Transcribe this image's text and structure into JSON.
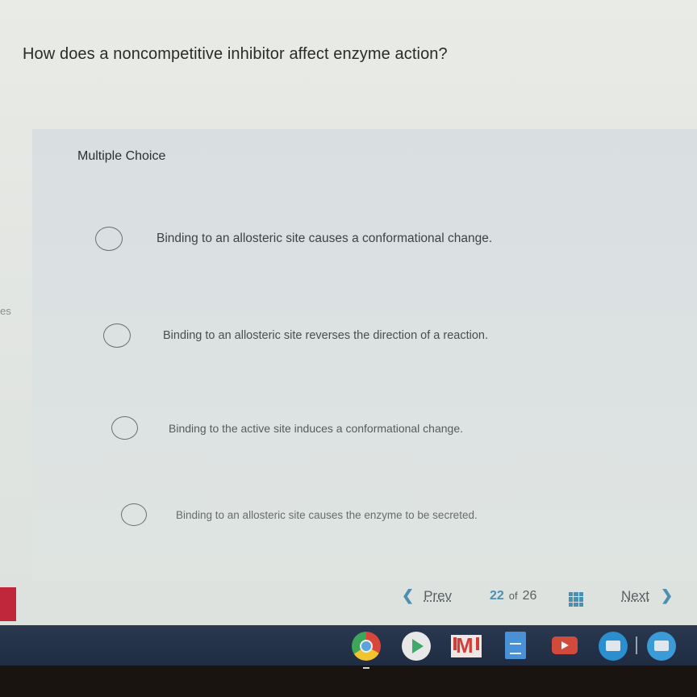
{
  "question": {
    "text": "How does a noncompetitive inhibitor affect enzyme action?"
  },
  "left_edge": {
    "partial_label": "es"
  },
  "multiple_choice": {
    "label": "Multiple Choice",
    "options": [
      {
        "text": "Binding to an allosteric site causes a conformational change.",
        "selected": false
      },
      {
        "text": "Binding to an allosteric site reverses the direction of a reaction.",
        "selected": false
      },
      {
        "text": "Binding to the active site induces a conformational change.",
        "selected": false
      },
      {
        "text": "Binding to an allosteric site causes the enzyme to be secreted.",
        "selected": false
      }
    ]
  },
  "navigation": {
    "prev_label": "Prev",
    "prev_icon": "chevron-left-icon",
    "current_page": "22",
    "of_label": "of",
    "total_pages": "26",
    "grid_icon": "grid-icon",
    "next_label": "Next",
    "next_icon": "chevron-right-icon",
    "accent_color": "#4d8fb0"
  },
  "shelf": {
    "apps": [
      {
        "name": "Chrome",
        "icon": "chrome-icon"
      },
      {
        "name": "Play Store",
        "icon": "play-store-icon"
      },
      {
        "name": "Gmail",
        "icon": "gmail-icon"
      },
      {
        "name": "Docs",
        "icon": "docs-icon"
      },
      {
        "name": "YouTube",
        "icon": "youtube-icon"
      },
      {
        "name": "Files",
        "icon": "files-icon"
      },
      {
        "name": "Files",
        "icon": "files-icon"
      }
    ]
  }
}
